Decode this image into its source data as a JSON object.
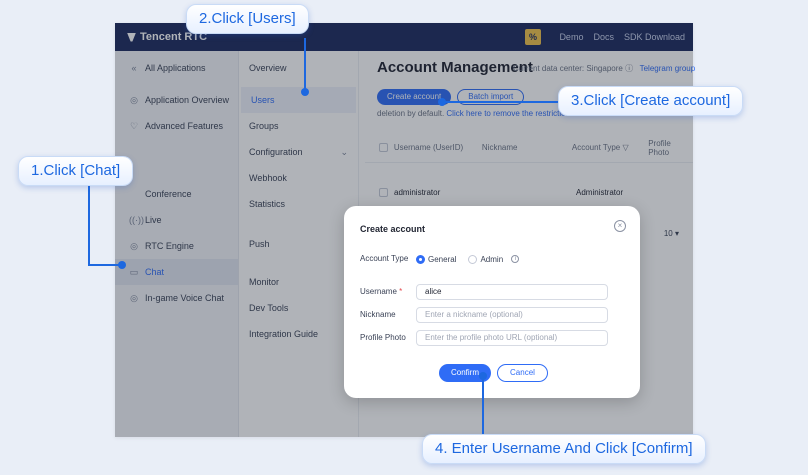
{
  "app": {
    "brand": "Tencent RTC",
    "promo_badge": "%",
    "nav": [
      "Demo",
      "Docs",
      "SDK Download"
    ]
  },
  "sidebar_main": [
    {
      "icon": "«",
      "label": "All Applications"
    },
    {
      "icon": "◎",
      "label": "Application Overview"
    },
    {
      "icon": "♡",
      "label": "Advanced Features"
    },
    {
      "icon": "",
      "label": ""
    },
    {
      "icon": "",
      "label": "Conference"
    },
    {
      "icon": "((·))",
      "label": "Live"
    },
    {
      "icon": "◎",
      "label": "RTC Engine"
    },
    {
      "icon": "▭",
      "label": "Chat"
    },
    {
      "icon": "◎",
      "label": "In-game Voice Chat"
    }
  ],
  "sidebar_sub": [
    {
      "label": "Overview"
    },
    {
      "label": "Users"
    },
    {
      "label": "Groups"
    },
    {
      "label": "Configuration",
      "chevron": "⌄"
    },
    {
      "label": "Webhook"
    },
    {
      "label": "Statistics"
    },
    {
      "label": "Push"
    },
    {
      "label": "Monitor"
    },
    {
      "label": "Dev Tools"
    },
    {
      "label": "Integration Guide"
    }
  ],
  "main": {
    "title": "Account Management",
    "data_center": "Current data center: Singapore ⓘ",
    "telegram_link": "Telegram group",
    "create_button": "Create account",
    "batch_button": "Batch import",
    "note_text": "deletion by default.",
    "note_link": "Click here to remove the restriction",
    "table_headers": [
      "Username (UserID)",
      "Nickname",
      "Account Type ▽",
      "Profile Photo"
    ],
    "row": {
      "username": "administrator",
      "account_type": "Administrator"
    },
    "page_size": "10 ▾"
  },
  "modal": {
    "title": "Create account",
    "close": "×",
    "account_type_label": "Account Type",
    "radio_general": "General",
    "radio_admin": "Admin",
    "username_label": "Username",
    "required_mark": "*",
    "username_value": "alice",
    "nickname_label": "Nickname",
    "nickname_placeholder": "Enter a nickname (optional)",
    "photo_label": "Profile Photo",
    "photo_placeholder": "Enter the profile photo URL (optional)",
    "confirm": "Confirm",
    "cancel": "Cancel"
  },
  "callouts": {
    "step1": "1.Click [Chat]",
    "step2": "2.Click [Users]",
    "step3": "3.Click [Create account]",
    "step4": "4. Enter Username And Click [Confirm]"
  },
  "colors": {
    "accent": "#2f6cf6",
    "topbar": "#1c2a5e",
    "callout": "#1d68e0"
  }
}
